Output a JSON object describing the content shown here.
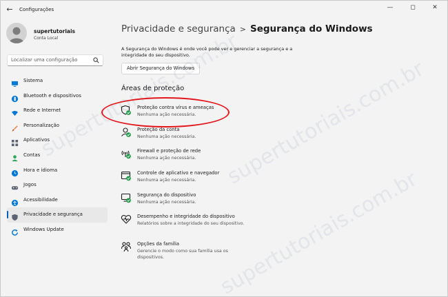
{
  "window": {
    "title": "Configurações"
  },
  "user": {
    "name": "supertutoriais",
    "role": "Conta Local"
  },
  "search": {
    "placeholder": "Localizar uma configuração"
  },
  "sidebar": {
    "items": [
      {
        "label": "Sistema",
        "icon": "monitor-icon",
        "color": "#0078d4"
      },
      {
        "label": "Bluetooth e dispositivos",
        "icon": "bluetooth-icon",
        "color": "#0078d4"
      },
      {
        "label": "Rede e Internet",
        "icon": "wifi-icon",
        "color": "#0078d4"
      },
      {
        "label": "Personalização",
        "icon": "brush-icon",
        "color": "#e3742a"
      },
      {
        "label": "Aplicativos",
        "icon": "apps-icon",
        "color": "#5b6470"
      },
      {
        "label": "Contas",
        "icon": "account-icon",
        "color": "#2fa85b"
      },
      {
        "label": "Hora e idioma",
        "icon": "globe-clock-icon",
        "color": "#0078d4"
      },
      {
        "label": "Jogos",
        "icon": "gamepad-icon",
        "color": "#5b6470"
      },
      {
        "label": "Acessibilidade",
        "icon": "accessibility-icon",
        "color": "#0078d4"
      },
      {
        "label": "Privacidade e segurança",
        "icon": "shield-icon",
        "color": "#5b6470",
        "active": true
      },
      {
        "label": "Windows Update",
        "icon": "update-icon",
        "color": "#0078d4"
      }
    ]
  },
  "breadcrumb": {
    "parent": "Privacidade e segurança",
    "separator": ">",
    "current": "Segurança do Windows"
  },
  "description": "A Segurança do Windows é onde você pode ver e gerenciar a segurança e a integridade do seu dispositivo.",
  "open_button": "Abrir Segurança do Windows",
  "section_title": "Áreas de proteção",
  "areas": [
    {
      "title": "Proteção contra vírus e ameaças",
      "subtitle": "Nenhuma ação necessária.",
      "icon": "virus-shield-icon"
    },
    {
      "title": "Proteção da conta",
      "subtitle": "Nenhuma ação necessária.",
      "icon": "account-protection-icon"
    },
    {
      "title": "Firewall e proteção de rede",
      "subtitle": "Nenhuma ação necessária.",
      "icon": "firewall-icon"
    },
    {
      "title": "Controle de aplicativo e navegador",
      "subtitle": "Nenhuma ação necessária.",
      "icon": "app-browser-icon"
    },
    {
      "title": "Segurança do dispositivo",
      "subtitle": "Nenhuma ação necessária.",
      "icon": "device-security-icon"
    },
    {
      "title": "Desempenho e integridade do dispositivo",
      "subtitle": "Relatórios sobre a integridade do seu dispositivo.",
      "icon": "heart-pulse-icon"
    },
    {
      "title": "Opções da família",
      "subtitle": "Gerencie o modo como sua família usa os dispositivos.",
      "icon": "family-icon"
    }
  ],
  "watermark": "supertutoriais.com.br",
  "colors": {
    "accent": "#005fb8",
    "ok": "#1f9d4a",
    "highlight": "#e4161b"
  }
}
